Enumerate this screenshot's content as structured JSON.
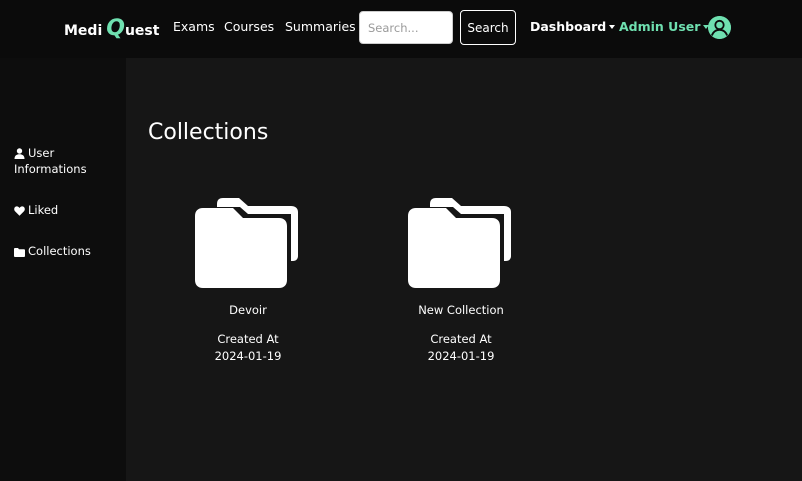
{
  "brand": {
    "part1": "Medi",
    "part2": "Q",
    "part3": "uest"
  },
  "nav": {
    "links": [
      {
        "label": "Exams"
      },
      {
        "label": "Courses"
      },
      {
        "label": "Summaries"
      }
    ],
    "search": {
      "placeholder": "Search...",
      "value": "",
      "button_label": "Search"
    },
    "dashboard_label": "Dashboard",
    "admin_label": "Admin User",
    "accent_color": "#6fe0b0"
  },
  "sidebar": {
    "items": [
      {
        "label": "User Informations",
        "icon": "user-icon"
      },
      {
        "label": "Liked",
        "icon": "heart-icon"
      },
      {
        "label": "Collections",
        "icon": "folder-icon"
      }
    ]
  },
  "main": {
    "title": "Collections",
    "created_label": "Created At",
    "collections": [
      {
        "name": "Devoir",
        "created_at": "2024-01-19",
        "icon": "folder-icon"
      },
      {
        "name": "New Collection",
        "created_at": "2024-01-19",
        "icon": "folder-icon"
      }
    ]
  }
}
